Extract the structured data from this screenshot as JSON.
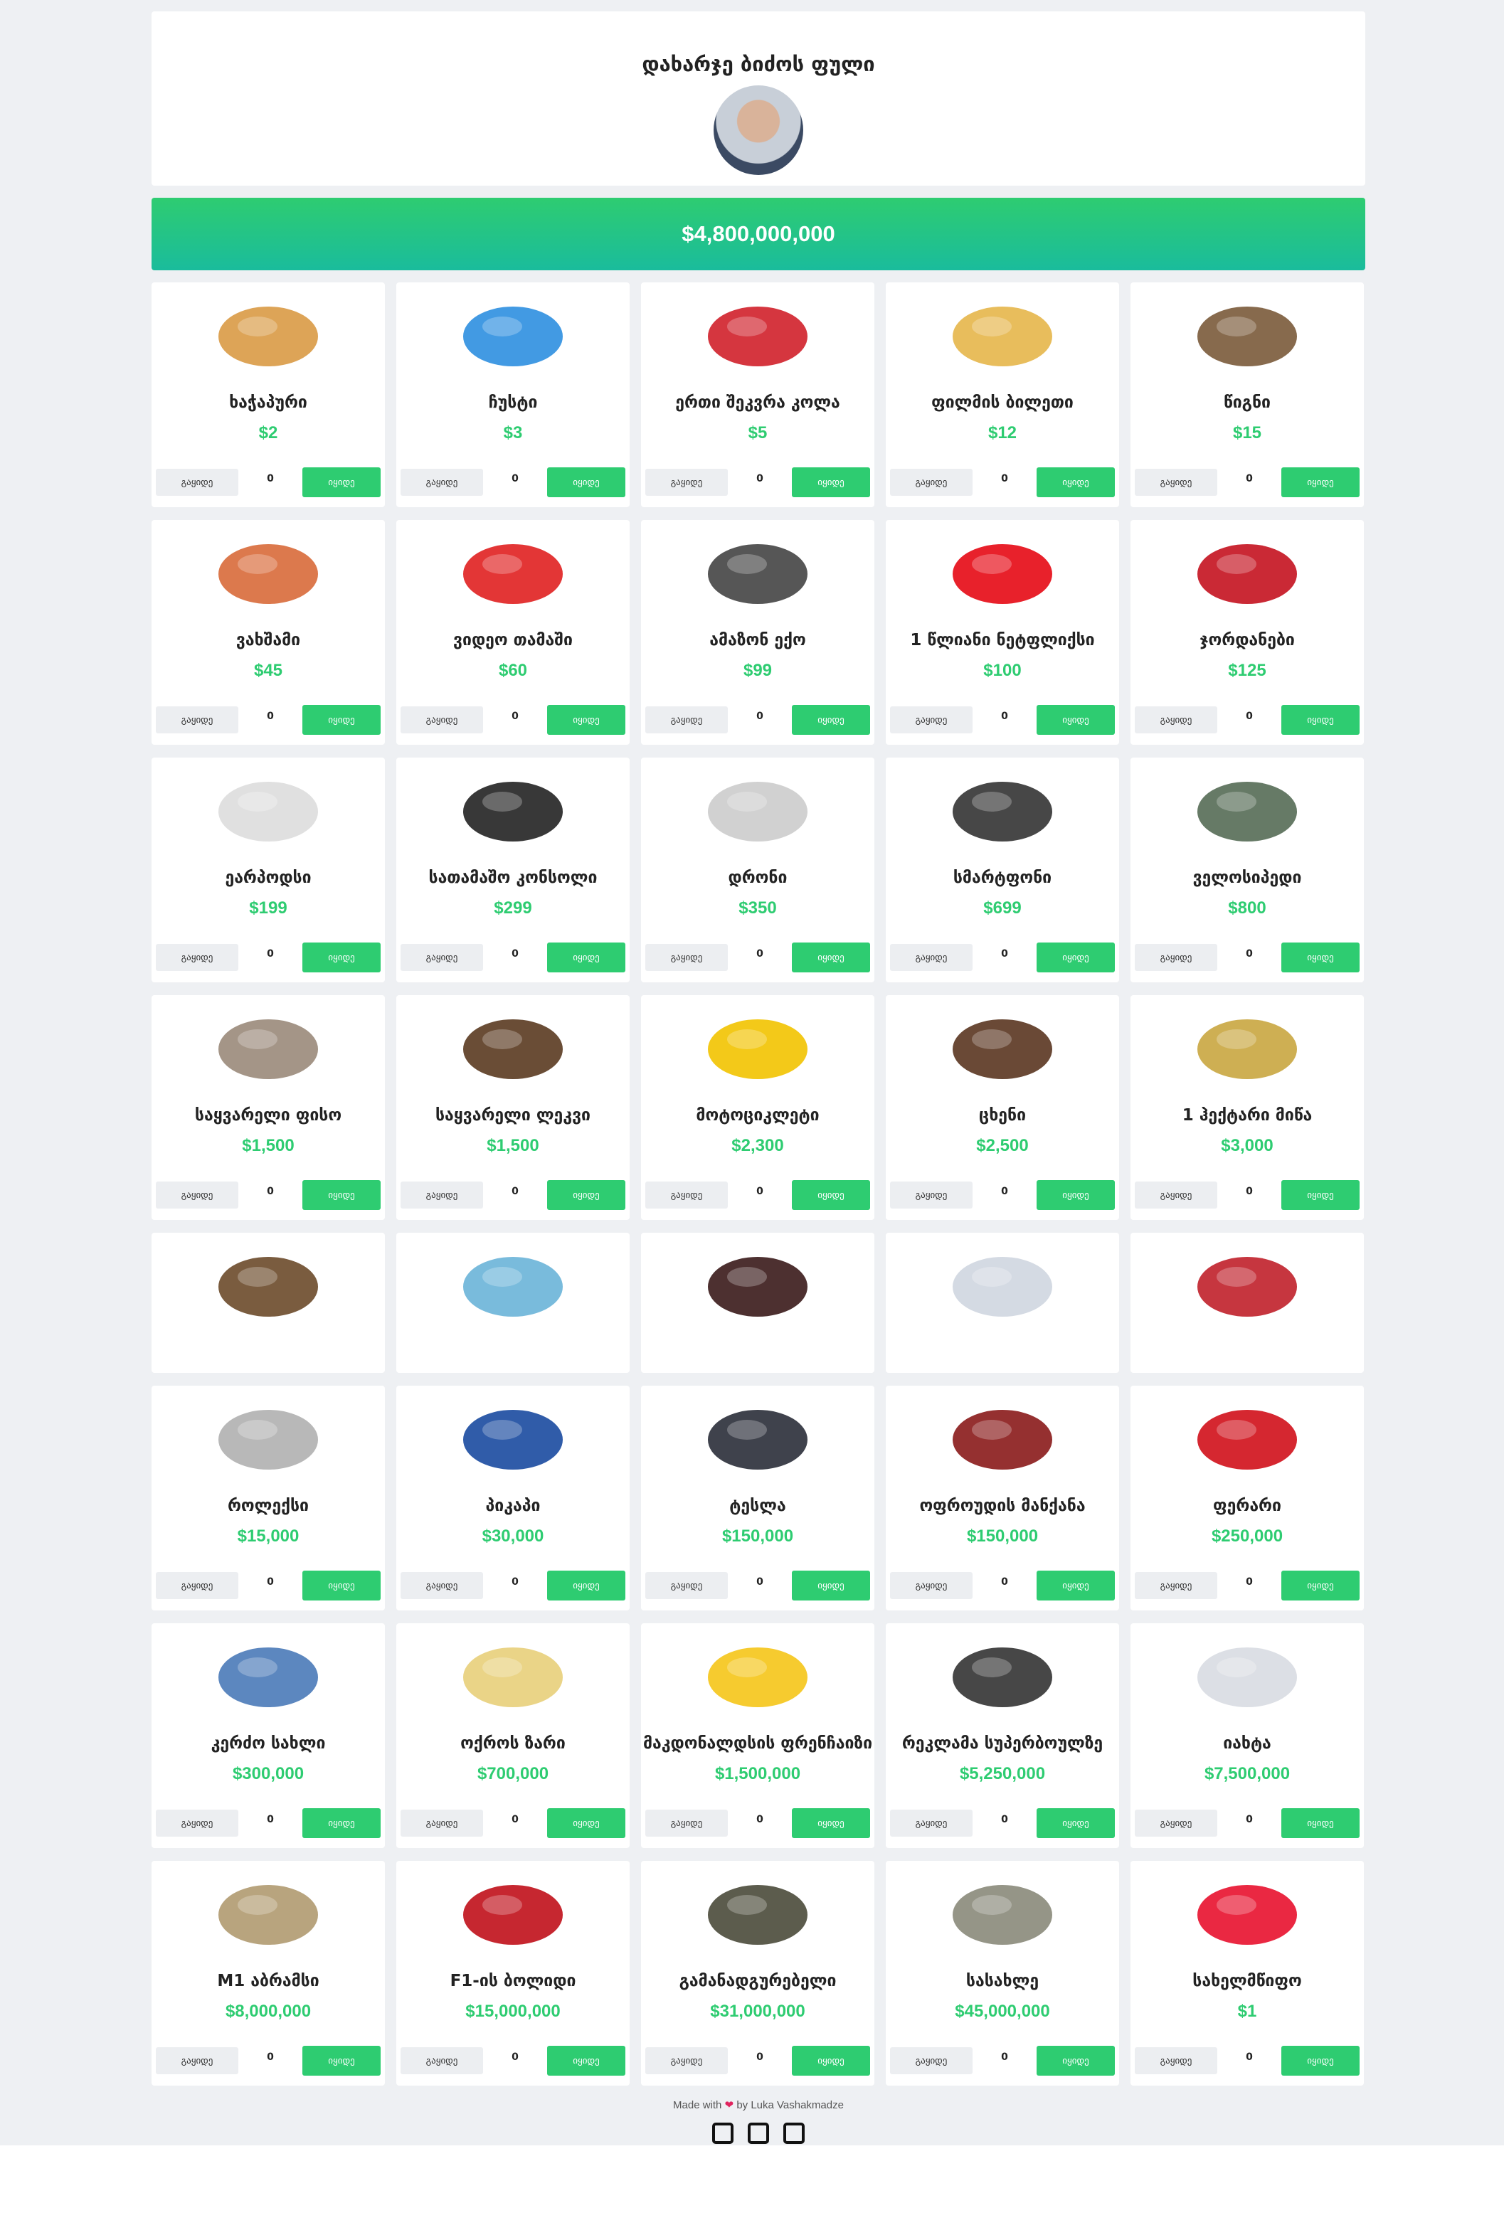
{
  "header": {
    "title": "დახარჯე ბიძოს ფული",
    "avatar": "avatar-photo"
  },
  "balance": "$4,800,000,000",
  "buttons": {
    "sell": "გაყიდე",
    "buy": "იყიდე"
  },
  "items": [
    {
      "name": "ხაჭაპური",
      "price": "$2",
      "count": "0",
      "icon": "khachapuri-icon",
      "color": "#d99a45"
    },
    {
      "name": "ჩუსტი",
      "price": "$3",
      "count": "0",
      "icon": "flip-flops-icon",
      "color": "#2d8fe0"
    },
    {
      "name": "ერთი შეკვრა კოლა",
      "price": "$5",
      "count": "0",
      "icon": "cola-pack-icon",
      "color": "#d0202a"
    },
    {
      "name": "ფილმის ბილეთი",
      "price": "$12",
      "count": "0",
      "icon": "movie-ticket-icon",
      "color": "#e6b64a"
    },
    {
      "name": "წიგნი",
      "price": "$15",
      "count": "0",
      "icon": "book-icon",
      "color": "#7a5a3a"
    },
    {
      "name": "ვახშამი",
      "price": "$45",
      "count": "0",
      "icon": "dinner-icon",
      "color": "#d86a3a"
    },
    {
      "name": "ვიდეო თამაში",
      "price": "$60",
      "count": "0",
      "icon": "video-game-icon",
      "color": "#e02020"
    },
    {
      "name": "ამაზონ ექო",
      "price": "$99",
      "count": "0",
      "icon": "amazon-echo-icon",
      "color": "#444"
    },
    {
      "name": "1 წლიანი ნეტფლიქსი",
      "price": "$100",
      "count": "0",
      "icon": "netflix-icon",
      "color": "#e50914"
    },
    {
      "name": "ჯორდანები",
      "price": "$125",
      "count": "0",
      "icon": "sneakers-icon",
      "color": "#c4121f"
    },
    {
      "name": "ეარპოდსი",
      "price": "$199",
      "count": "0",
      "icon": "airpods-icon",
      "color": "#ddd"
    },
    {
      "name": "სათამაშო კონსოლი",
      "price": "$299",
      "count": "0",
      "icon": "game-console-icon",
      "color": "#222"
    },
    {
      "name": "დრონი",
      "price": "$350",
      "count": "0",
      "icon": "drone-icon",
      "color": "#ccc"
    },
    {
      "name": "სმარტფონი",
      "price": "$699",
      "count": "0",
      "icon": "smartphone-icon",
      "color": "#333"
    },
    {
      "name": "ველოსიპედი",
      "price": "$800",
      "count": "0",
      "icon": "bicycle-icon",
      "color": "#556b55"
    },
    {
      "name": "საყვარელი ფისო",
      "price": "$1,500",
      "count": "0",
      "icon": "kitten-icon",
      "color": "#9a8a7a"
    },
    {
      "name": "საყვარელი ლეკვი",
      "price": "$1,500",
      "count": "0",
      "icon": "puppy-icon",
      "color": "#5a3a20"
    },
    {
      "name": "მოტოციკლეტი",
      "price": "$2,300",
      "count": "0",
      "icon": "rickshaw-icon",
      "color": "#f2c300"
    },
    {
      "name": "ცხენი",
      "price": "$2,500",
      "count": "0",
      "icon": "horse-icon",
      "color": "#5a3520"
    },
    {
      "name": "1 ჰექტარი მიწა",
      "price": "$3,000",
      "count": "0",
      "icon": "hay-field-icon",
      "color": "#c9a640"
    },
    {
      "name": "",
      "price": "",
      "count": "",
      "icon": "handbag-icon",
      "color": "#6b4a2a",
      "short": true
    },
    {
      "name": "",
      "price": "",
      "count": "",
      "icon": "hot-tub-icon",
      "color": "#6ab4d8",
      "short": true
    },
    {
      "name": "",
      "price": "",
      "count": "",
      "icon": "wine-bottle-icon",
      "color": "#3a1a1a",
      "short": true
    },
    {
      "name": "",
      "price": "",
      "count": "",
      "icon": "diamond-ring-icon",
      "color": "#cfd6e0",
      "short": true
    },
    {
      "name": "",
      "price": "",
      "count": "",
      "icon": "jet-ski-icon",
      "color": "#c0202a",
      "short": true
    },
    {
      "name": "როლექსი",
      "price": "$15,000",
      "count": "0",
      "icon": "rolex-icon",
      "color": "#b0b0b0"
    },
    {
      "name": "პიკაპი",
      "price": "$30,000",
      "count": "0",
      "icon": "pickup-truck-icon",
      "color": "#1a4aa0"
    },
    {
      "name": "ტესლა",
      "price": "$150,000",
      "count": "0",
      "icon": "tesla-icon",
      "color": "#2a2e38"
    },
    {
      "name": "ოფროუდის მანქანა",
      "price": "$150,000",
      "count": "0",
      "icon": "monster-truck-icon",
      "color": "#8a1a1a"
    },
    {
      "name": "ფერარი",
      "price": "$250,000",
      "count": "0",
      "icon": "ferrari-icon",
      "color": "#d0101a"
    },
    {
      "name": "კერძო სახლი",
      "price": "$300,000",
      "count": "0",
      "icon": "house-icon",
      "color": "#4a7ab8"
    },
    {
      "name": "ოქროს ზარი",
      "price": "$700,000",
      "count": "0",
      "icon": "gold-bar-icon",
      "color": "#e8cf7a"
    },
    {
      "name": "მაკდონალდსის ფრენჩაიზი",
      "price": "$1,500,000",
      "count": "0",
      "icon": "mcdonalds-icon",
      "color": "#f5c518"
    },
    {
      "name": "რეკლამა სუპერბოულზე",
      "price": "$5,250,000",
      "count": "0",
      "icon": "football-player-icon",
      "color": "#333"
    },
    {
      "name": "იახტა",
      "price": "$7,500,000",
      "count": "0",
      "icon": "yacht-icon",
      "color": "#d8dce2"
    },
    {
      "name": "M1 აბრამსი",
      "price": "$8,000,000",
      "count": "0",
      "icon": "tank-icon",
      "color": "#b09a70"
    },
    {
      "name": "F1-ის ბოლიდი",
      "price": "$15,000,000",
      "count": "0",
      "icon": "f1-car-icon",
      "color": "#c0101a"
    },
    {
      "name": "გამანადგურებელი",
      "price": "$31,000,000",
      "count": "0",
      "icon": "helicopter-icon",
      "color": "#4a4a3a"
    },
    {
      "name": "სასახლე",
      "price": "$45,000,000",
      "count": "0",
      "icon": "mansion-icon",
      "color": "#8a8a7a"
    },
    {
      "name": "სახელმწიფო",
      "price": "$1",
      "count": "0",
      "icon": "georgia-flag-icon",
      "color": "#e8112d"
    }
  ],
  "footer": {
    "made": "Made with",
    "by": "by Luka Vashakmadze"
  },
  "social": [
    "facebook-icon",
    "github-icon",
    "instagram-icon"
  ]
}
